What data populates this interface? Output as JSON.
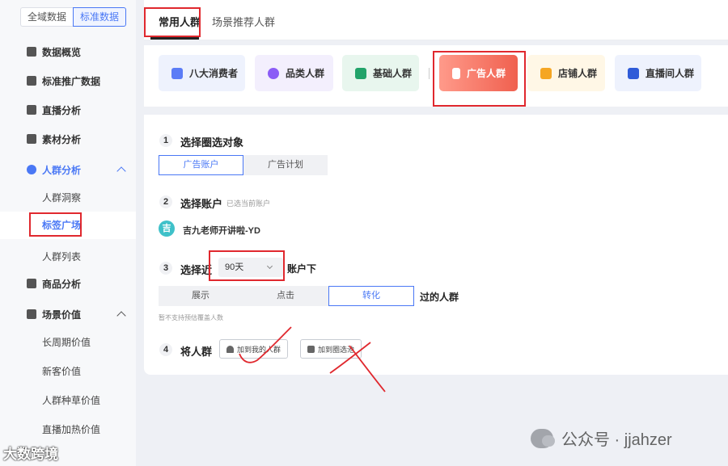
{
  "sidebar": {
    "scope_tabs": [
      "全域数据",
      "标准数据"
    ],
    "nav": [
      {
        "label": "数据概览",
        "icon": "dashboard-icon"
      },
      {
        "label": "标准推广数据",
        "icon": "chart-icon"
      },
      {
        "label": "直播分析",
        "icon": "live-icon"
      },
      {
        "label": "素材分析",
        "icon": "layers-icon"
      },
      {
        "label": "人群分析",
        "icon": "users-icon"
      },
      {
        "label": "商品分析",
        "icon": "bag-icon"
      },
      {
        "label": "场景价值",
        "icon": "diamond-icon"
      }
    ],
    "crowd_sub": [
      "人群洞察",
      "标签广场",
      "人群列表"
    ],
    "scene_sub": [
      "长周期价值",
      "新客价值",
      "人群种草价值",
      "直播加热价值"
    ]
  },
  "top_tabs": [
    "常用人群",
    "场景推荐人群"
  ],
  "cards": [
    {
      "label": "八大消费者",
      "icon": "consumer-icon",
      "color": "#5b7cf6"
    },
    {
      "label": "品类人群",
      "icon": "category-icon",
      "color": "#8b5cf6"
    },
    {
      "label": "基础人群",
      "icon": "basic-icon",
      "color": "#22a36a"
    },
    {
      "label": "广告人群",
      "icon": "ad-icon",
      "color": "#ffffff"
    },
    {
      "label": "店铺人群",
      "icon": "store-icon",
      "color": "#f5a623"
    },
    {
      "label": "直播间人群",
      "icon": "tiktok-icon",
      "color": "#2f5bd8"
    }
  ],
  "form": {
    "step1": {
      "num": "1",
      "title": "选择圈选对象",
      "options": [
        "广告账户",
        "广告计划"
      ]
    },
    "step2": {
      "num": "2",
      "title": "选择账户",
      "hint": "已选当前账户",
      "avatar": "吉",
      "account": "吉九老师开讲啦-YD"
    },
    "step3": {
      "num": "3",
      "title": "选择近",
      "select": "90天",
      "suffix": "账户下",
      "options": [
        "展示",
        "点击",
        "转化"
      ],
      "tail": "过的人群",
      "note": "暂不支持预估覆盖人数"
    },
    "step4": {
      "num": "4",
      "title": "将人群",
      "buttons": [
        "加到我的人群",
        "加到圈选池"
      ]
    }
  },
  "watermark": {
    "right": "公众号 · jjahzer",
    "left": "大数跨境"
  }
}
